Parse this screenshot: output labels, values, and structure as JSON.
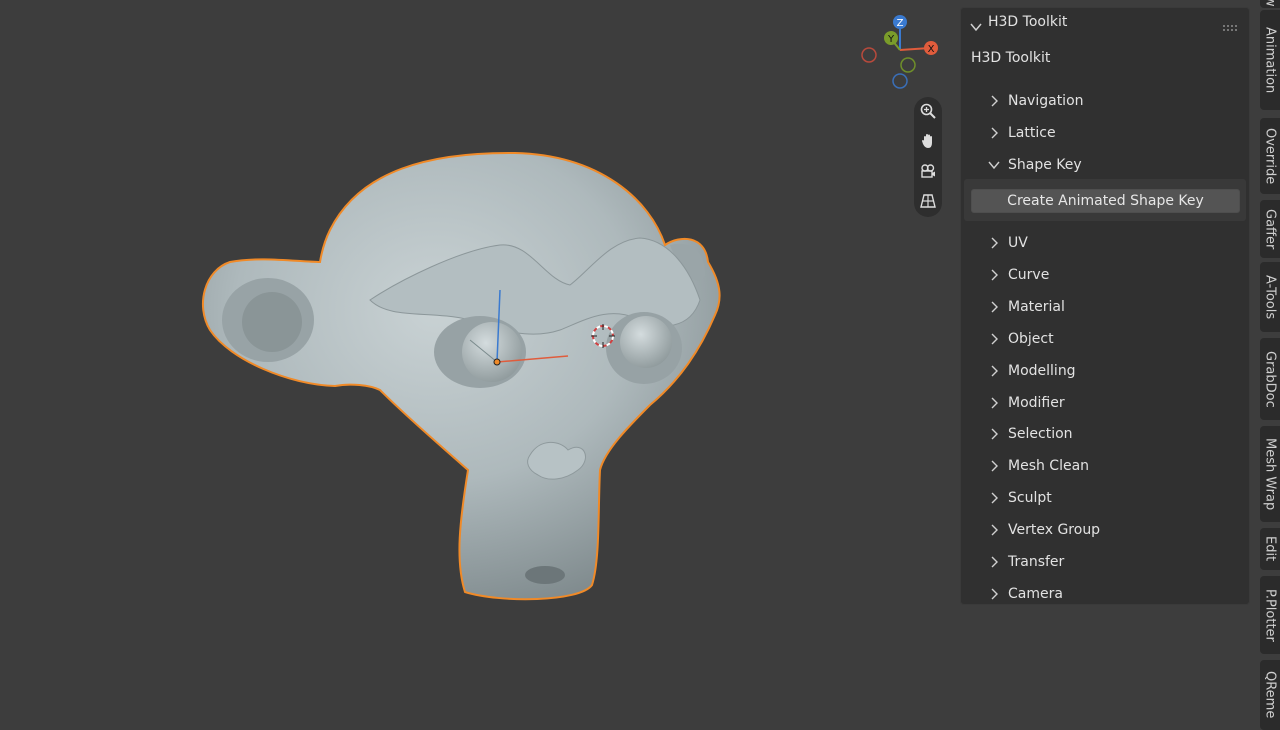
{
  "gizmo": {
    "z_label": "Z",
    "y_label": "Y",
    "x_label": "X"
  },
  "npanel": {
    "header_title": "H3D Toolkit",
    "subtitle": "H3D Toolkit",
    "sections_top": [
      "Navigation",
      "Lattice",
      "Shape Key"
    ],
    "shape_key_button": "Create Animated Shape Key",
    "sections_bottom": [
      "UV",
      "Curve",
      "Material",
      "Object",
      "Modelling",
      "Modifier",
      "Selection",
      "Mesh Clean",
      "Sculpt",
      "Vertex Group",
      "Transfer",
      "Camera"
    ]
  },
  "tabs": [
    "w",
    "Animation",
    "Override",
    "Gaffer",
    "A-Tools",
    "GrabDoc",
    "Mesh Wrap",
    "Edit",
    "P.Plotter",
    "QReme"
  ],
  "colors": {
    "background": "#3d3d3d",
    "selection_outline": "#f08a28",
    "axis_x": "#e05c3c",
    "axis_y": "#7a9c2a",
    "axis_z": "#3a7ad0"
  }
}
